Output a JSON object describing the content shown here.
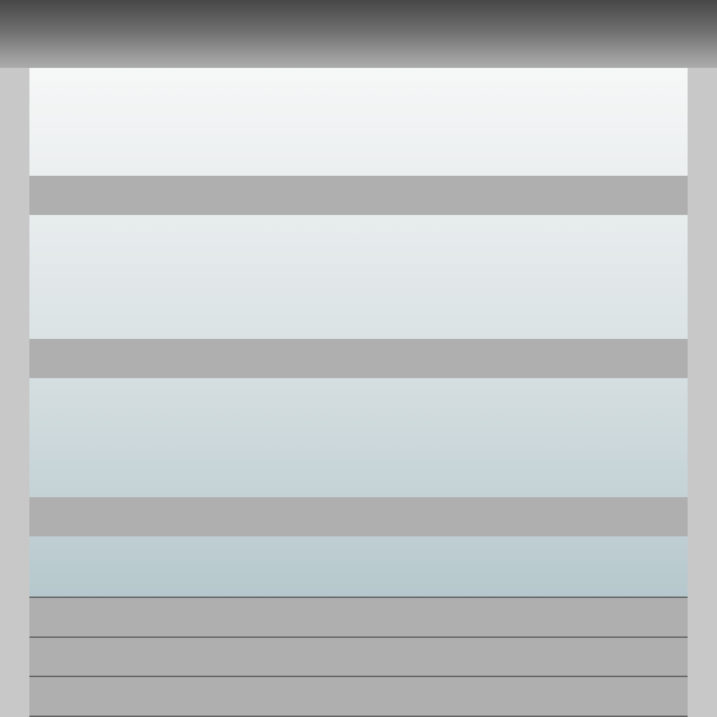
{
  "colors": {
    "top_bar_dark": "#474747",
    "top_bar_light": "#ababab",
    "margin": "#c8c8c8",
    "panel_top": "#f6f7f7",
    "panel_bottom": "#b6c8cd",
    "band": "#afafaf",
    "slat_line": "#636363"
  }
}
